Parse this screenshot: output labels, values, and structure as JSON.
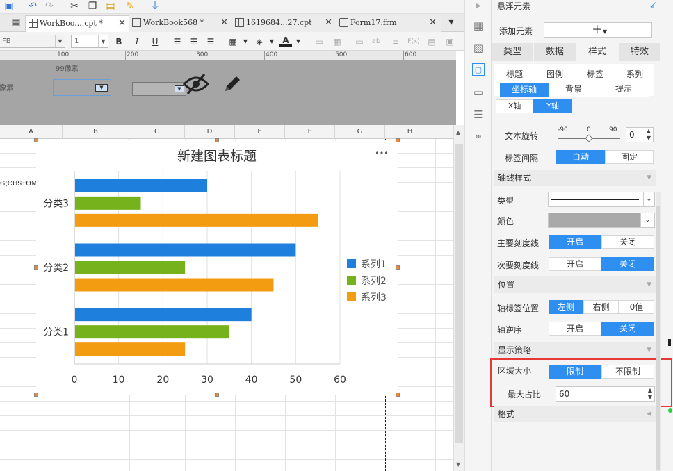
{
  "tabs": [
    {
      "label": "WorkBoo....cpt *",
      "active": true
    },
    {
      "label": "WorkBook568 *",
      "active": false
    },
    {
      "label": "1619684...27.cpt",
      "active": false
    },
    {
      "label": "Form17.frm",
      "active": false
    }
  ],
  "format_bar": {
    "font_value": "FB",
    "size_value": "1",
    "bold": "B",
    "italic": "I",
    "underline": "U",
    "color_letter": "A",
    "fx": "F(x)"
  },
  "ruler": {
    "labels": [
      "100",
      "200",
      "300",
      "400",
      "500",
      "600"
    ]
  },
  "form_area": {
    "width_label": "99像素",
    "left_label": "像素"
  },
  "columns": [
    "A",
    "B",
    "C",
    "D",
    "E",
    "F",
    "G",
    "H"
  ],
  "cell_text": "G(CUSTOME",
  "chart_data": {
    "type": "bar",
    "orientation": "horizontal",
    "title": "新建图表标题",
    "categories": [
      "分类1",
      "分类2",
      "分类3"
    ],
    "series": [
      {
        "name": "系列1",
        "color": "#1f7fdc",
        "values": [
          40,
          50,
          30
        ]
      },
      {
        "name": "系列2",
        "color": "#76b21b",
        "values": [
          35,
          25,
          15
        ]
      },
      {
        "name": "系列3",
        "color": "#f39c12",
        "values": [
          25,
          45,
          55
        ]
      }
    ],
    "xlim": [
      0,
      60
    ],
    "xticks": [
      "0",
      "10",
      "20",
      "30",
      "40",
      "50",
      "60"
    ],
    "grid": true,
    "legend": "right",
    "menu_glyph": "•••"
  },
  "panel": {
    "title": "悬浮元素",
    "add_element": "添加元素",
    "add_symbol": "＋",
    "main_tabs": [
      {
        "label": "类型",
        "active": false
      },
      {
        "label": "数据",
        "active": false
      },
      {
        "label": "样式",
        "active": true
      },
      {
        "label": "特效",
        "active": false
      }
    ],
    "style_tabs_row1": [
      "标题",
      "图例",
      "标签",
      "系列"
    ],
    "style_tabs_row2": [
      {
        "label": "坐标轴",
        "active": true
      },
      {
        "label": "背景",
        "active": false
      },
      {
        "label": "提示",
        "active": false
      }
    ],
    "axis_tabs": [
      {
        "label": "X轴",
        "active": false
      },
      {
        "label": "Y轴",
        "active": true
      }
    ],
    "text_rotation": {
      "label": "文本旋转",
      "ticks": [
        "-90",
        "0",
        "90"
      ],
      "value": "0"
    },
    "label_interval": {
      "label": "标签间隔",
      "options": [
        {
          "label": "自动",
          "on": true
        },
        {
          "label": "固定",
          "on": false
        }
      ]
    },
    "section_axis_style": "轴线样式",
    "type_label": "类型",
    "color_label": "颜色",
    "major_ticks": {
      "label": "主要刻度线",
      "options": [
        {
          "label": "开启",
          "on": true
        },
        {
          "label": "关闭",
          "on": false
        }
      ]
    },
    "minor_ticks": {
      "label": "次要刻度线",
      "options": [
        {
          "label": "开启",
          "on": false
        },
        {
          "label": "关闭",
          "on": true
        }
      ]
    },
    "section_position": "位置",
    "label_position": {
      "label": "轴标签位置",
      "options": [
        {
          "label": "左侧",
          "on": true
        },
        {
          "label": "右侧",
          "on": false
        },
        {
          "label": "0值",
          "on": false
        }
      ]
    },
    "reverse": {
      "label": "轴逆序",
      "options": [
        {
          "label": "开启",
          "on": false
        },
        {
          "label": "关闭",
          "on": true
        }
      ]
    },
    "section_display": "显示策略",
    "area_size": {
      "label": "区域大小",
      "options": [
        {
          "label": "限制",
          "on": true
        },
        {
          "label": "不限制",
          "on": false
        }
      ]
    },
    "max_ratio": {
      "label": "最大占比",
      "value": "60"
    },
    "section_format": "格式"
  }
}
